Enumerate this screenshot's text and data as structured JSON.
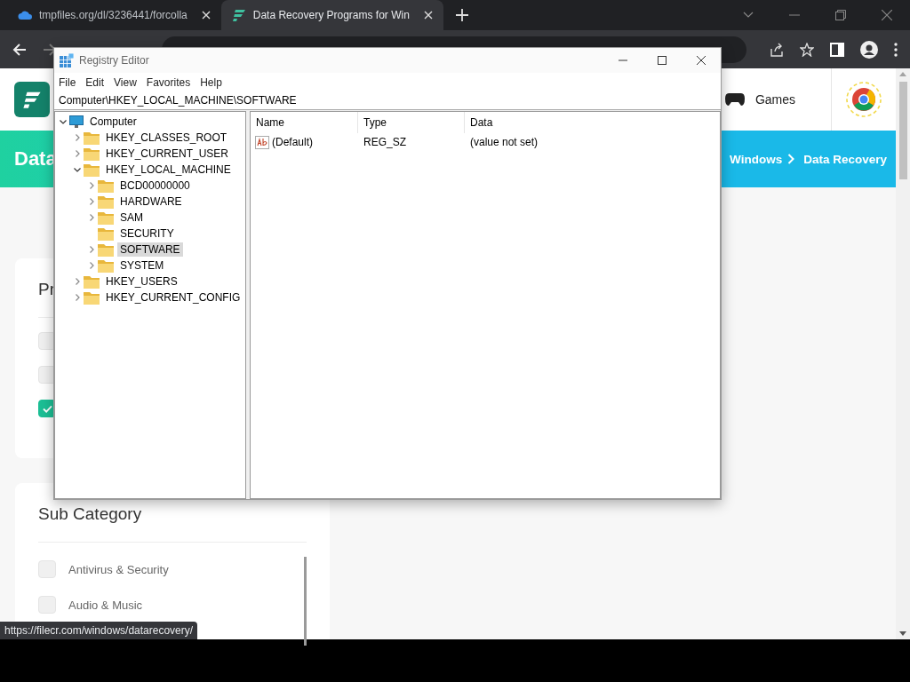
{
  "browser": {
    "tabs": [
      {
        "title": "tmpfiles.org/dl/3236441/forcolla",
        "selected": false
      },
      {
        "title": "Data Recovery Programs for Win",
        "selected": true
      }
    ]
  },
  "page": {
    "nav_item": "Games",
    "banner_title": "Data",
    "breadcrumb": [
      {
        "label": "Windows"
      },
      {
        "label": "Data Recovery"
      }
    ],
    "filter_card": {
      "title": "Pr",
      "options": [
        {
          "checked": false
        },
        {
          "checked": false
        },
        {
          "checked": true
        }
      ]
    },
    "sub_category": {
      "title": "Sub Category",
      "items": [
        {
          "label": "Antivirus & Security",
          "checked": false
        },
        {
          "label": "Audio & Music",
          "checked": false
        }
      ]
    }
  },
  "status_url": "https://filecr.com/windows/datarecovery/",
  "registry": {
    "title": "Registry Editor",
    "menu": [
      "File",
      "Edit",
      "View",
      "Favorites",
      "Help"
    ],
    "path": "Computer\\HKEY_LOCAL_MACHINE\\SOFTWARE",
    "tree": [
      {
        "label": "Computer",
        "kind": "computer",
        "expandable": true,
        "expanded": true,
        "selected": false,
        "children": [
          {
            "label": "HKEY_CLASSES_ROOT",
            "kind": "folder",
            "expandable": true,
            "expanded": false,
            "selected": false
          },
          {
            "label": "HKEY_CURRENT_USER",
            "kind": "folder",
            "expandable": true,
            "expanded": false,
            "selected": false
          },
          {
            "label": "HKEY_LOCAL_MACHINE",
            "kind": "folder",
            "expandable": true,
            "expanded": true,
            "selected": false,
            "children": [
              {
                "label": "BCD00000000",
                "kind": "folder",
                "expandable": true,
                "expanded": false,
                "selected": false
              },
              {
                "label": "HARDWARE",
                "kind": "folder",
                "expandable": true,
                "expanded": false,
                "selected": false
              },
              {
                "label": "SAM",
                "kind": "folder",
                "expandable": true,
                "expanded": false,
                "selected": false
              },
              {
                "label": "SECURITY",
                "kind": "folder",
                "expandable": false,
                "expanded": false,
                "selected": false
              },
              {
                "label": "SOFTWARE",
                "kind": "folder",
                "expandable": true,
                "expanded": false,
                "selected": true
              },
              {
                "label": "SYSTEM",
                "kind": "folder",
                "expandable": true,
                "expanded": false,
                "selected": false
              }
            ]
          },
          {
            "label": "HKEY_USERS",
            "kind": "folder",
            "expandable": true,
            "expanded": false,
            "selected": false
          },
          {
            "label": "HKEY_CURRENT_CONFIG",
            "kind": "folder",
            "expandable": true,
            "expanded": false,
            "selected": false
          }
        ]
      }
    ],
    "columns": [
      "Name",
      "Type",
      "Data"
    ],
    "values": [
      {
        "name": "(Default)",
        "type": "REG_SZ",
        "data": "(value not set)"
      }
    ]
  }
}
